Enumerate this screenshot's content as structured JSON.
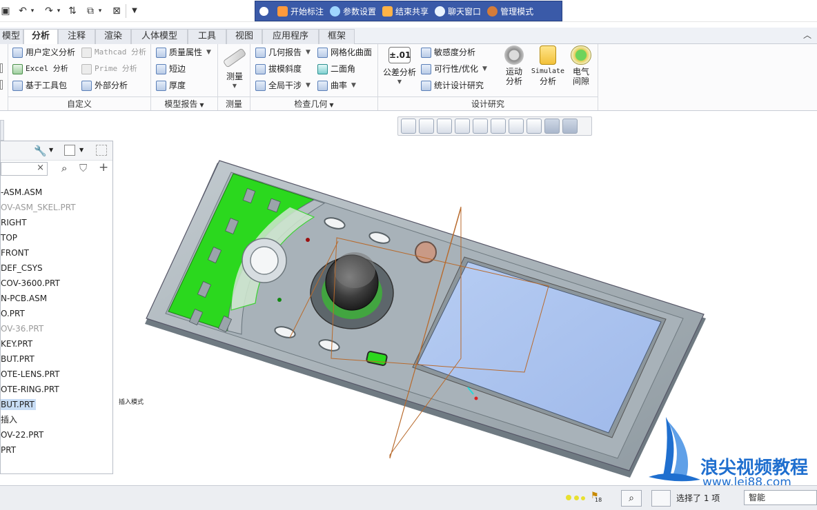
{
  "meeting_toolbar": {
    "items": [
      {
        "label": "开始标注",
        "icon": "pen-icon"
      },
      {
        "label": "参数设置",
        "icon": "settings-icon"
      },
      {
        "label": "结束共享",
        "icon": "stop-share-icon"
      },
      {
        "label": "聊天窗口",
        "icon": "chat-icon"
      },
      {
        "label": "管理模式",
        "icon": "admin-icon"
      }
    ]
  },
  "tabs": [
    "模型",
    "分析",
    "注释",
    "渲染",
    "人体模型",
    "工具",
    "视图",
    "应用程序",
    "框架"
  ],
  "active_tab": "分析",
  "ribbon": {
    "custom": {
      "items": [
        "用户定义分析",
        "Mathcad 分析",
        "Excel 分析",
        "Prime 分析",
        "基于工具包",
        "外部分析"
      ],
      "group": "自定义"
    },
    "model_report": {
      "items": [
        "质量属性",
        "短边",
        "厚度"
      ],
      "group": "模型报告"
    },
    "measure": {
      "label": "测量",
      "group": "测量"
    },
    "inspect": {
      "items": [
        "几何报告",
        "网格化曲面",
        "拔模斜度",
        "二面角",
        "全局干涉",
        "曲率"
      ],
      "group": "检查几何"
    },
    "design_study": {
      "tolerance_value": "±.01",
      "tolerance_label": "公差分析",
      "items": [
        "敏感度分析",
        "可行性/优化",
        "统计设计研究"
      ],
      "motion_label": "运动\n分析",
      "motion_line1": "运动",
      "motion_line2": "分析",
      "simulate_line1": "Simulate",
      "simulate_line2": "分析",
      "electrical_line1": "电气",
      "electrical_line2": "间隙",
      "group": "设计研究"
    }
  },
  "model_tree": {
    "rows": [
      {
        "text": "-ASM.ASM",
        "dim": false,
        "selected": false
      },
      {
        "text": "OV-ASM_SKEL.PRT",
        "dim": true,
        "selected": false
      },
      {
        "text": "RIGHT",
        "dim": false,
        "selected": false
      },
      {
        "text": "TOP",
        "dim": false,
        "selected": false
      },
      {
        "text": "FRONT",
        "dim": false,
        "selected": false
      },
      {
        "text": "DEF_CSYS",
        "dim": false,
        "selected": false
      },
      {
        "text": "COV-3600.PRT",
        "dim": false,
        "selected": false
      },
      {
        "text": "N-PCB.ASM",
        "dim": false,
        "selected": false
      },
      {
        "text": "O.PRT",
        "dim": false,
        "selected": false
      },
      {
        "text": "OV-36.PRT",
        "dim": true,
        "selected": false
      },
      {
        "text": "KEY.PRT",
        "dim": false,
        "selected": false
      },
      {
        "text": "BUT.PRT",
        "dim": false,
        "selected": false
      },
      {
        "text": "OTE-LENS.PRT",
        "dim": false,
        "selected": false
      },
      {
        "text": "OTE-RING.PRT",
        "dim": false,
        "selected": false
      },
      {
        "text": "BUT.PRT",
        "dim": false,
        "selected": true
      },
      {
        "text": "插入",
        "dim": false,
        "selected": false
      },
      {
        "text": "OV-22.PRT",
        "dim": false,
        "selected": false
      },
      {
        "text": "PRT",
        "dim": false,
        "selected": false
      }
    ]
  },
  "canvas": {
    "insert_mode_label": "插入模式"
  },
  "watermark": {
    "title": "浪尖视频教程",
    "url": "www.lej88.com"
  },
  "status": {
    "flag_count": "18",
    "selection_text": "选择了 1 项",
    "filter_value": "智能"
  },
  "colors": {
    "meeting_bg": "#3a5aa8",
    "highlight_green": "#2bd81e",
    "screen_blue": "#a9c4ef",
    "body_gray": "#a9b3ba"
  }
}
